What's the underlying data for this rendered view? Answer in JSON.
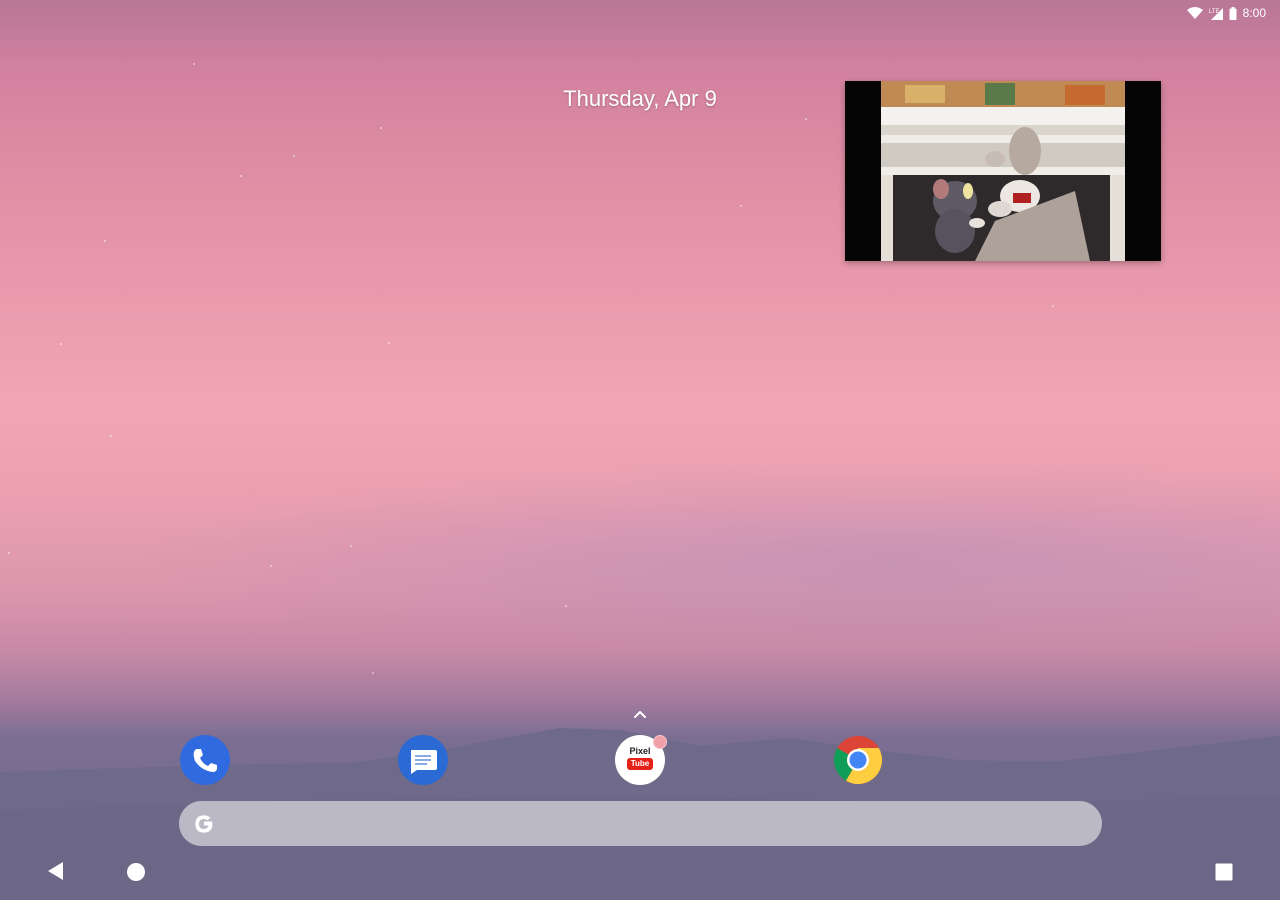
{
  "status_bar": {
    "time": "8:00",
    "icons": [
      "wifi-icon",
      "cell-signal-icon",
      "battery-icon"
    ]
  },
  "home": {
    "date": "Thursday, Apr 9"
  },
  "pip_video": {
    "content": "cartoon-cat-and-dog-scene"
  },
  "hotseat": {
    "apps": [
      {
        "name": "Phone",
        "icon": "phone-icon",
        "color": "#2f6ae0"
      },
      {
        "name": "Messages",
        "icon": "messages-icon",
        "color": "#2b6ad5"
      },
      {
        "name": "Pixel Tube",
        "icon": "pixel-tube-icon",
        "line1": "Pixel",
        "line2": "Tube"
      },
      {
        "name": "Chrome",
        "icon": "chrome-icon"
      }
    ],
    "drawer_icon": "chevron-up-icon"
  },
  "search": {
    "logo": "google-g-icon",
    "placeholder": ""
  },
  "nav_bar": {
    "icons": [
      "back-icon",
      "home-icon",
      "recents-icon"
    ]
  },
  "colors": {
    "sky_top": "#b87796",
    "sky_mid": "#f0a6b4",
    "mountain": "#6f6a8a",
    "search_bar": "#c8c8d0"
  }
}
